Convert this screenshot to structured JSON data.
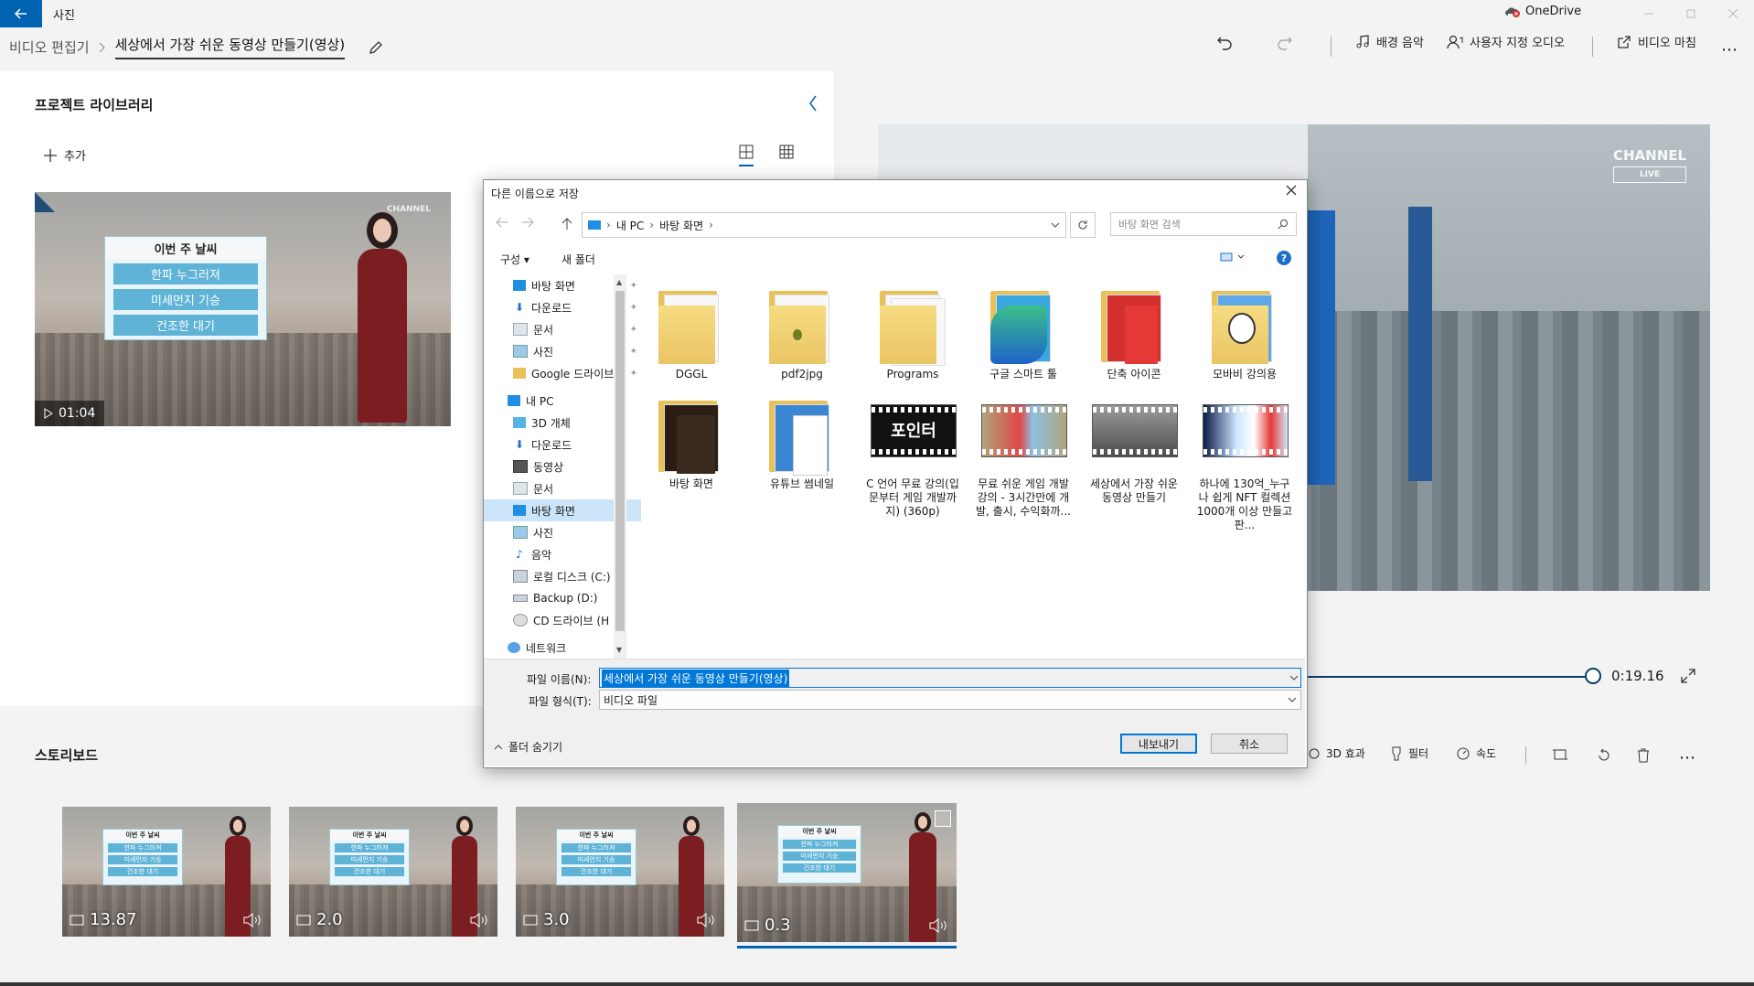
{
  "app": {
    "title": "사진",
    "onedrive_label": "OneDrive"
  },
  "header": {
    "breadcrumb_root": "비디오 편집기",
    "project_title": "세상에서 가장 쉬운 동영상 만들기(영상)",
    "toolbar": {
      "background_music": "배경 음악",
      "custom_audio": "사용자 지정 오디오",
      "finish_video": "비디오 마침"
    }
  },
  "library": {
    "title": "프로젝트 라이브러리",
    "add_label": "추가",
    "item": {
      "duration": "01:04",
      "board_heading": "이번 주 날씨",
      "board_items": [
        "한파 누그러져",
        "미세먼지 기승",
        "건조한 대기"
      ]
    }
  },
  "preview": {
    "current_time": "0:19.16",
    "logo_text": "CHANNEL",
    "logo_badge": "LIVE"
  },
  "storyboard": {
    "title": "스토리보드",
    "tools": [
      "3D 효과",
      "필터",
      "속도"
    ],
    "clips": [
      {
        "duration": "13.87"
      },
      {
        "duration": "2.0"
      },
      {
        "duration": "3.0"
      },
      {
        "duration": "0.3"
      }
    ]
  },
  "dialog": {
    "title": "다른 이름으로 저장",
    "address": [
      "내 PC",
      "바탕 화면"
    ],
    "search_placeholder": "바탕 화면 검색",
    "organize": "구성",
    "new_folder": "새 폴더",
    "help": "?",
    "nav_items": [
      {
        "label": "바탕 화면",
        "pinned": true
      },
      {
        "label": "다운로드",
        "pinned": true
      },
      {
        "label": "문서",
        "pinned": true
      },
      {
        "label": "사진",
        "pinned": true
      },
      {
        "label": "Google 드라이브",
        "pinned": true
      },
      {
        "label": "내 PC"
      },
      {
        "label": "3D 개체"
      },
      {
        "label": "다운로드"
      },
      {
        "label": "동영상"
      },
      {
        "label": "문서"
      },
      {
        "label": "바탕 화면",
        "selected": true
      },
      {
        "label": "사진"
      },
      {
        "label": "음악"
      },
      {
        "label": "로컬 디스크 (C:)"
      },
      {
        "label": "Backup (D:)"
      },
      {
        "label": "CD 드라이브 (H"
      },
      {
        "label": "네트워크"
      }
    ],
    "files": [
      {
        "name": "DGGL",
        "kind": "folder"
      },
      {
        "name": "pdf2jpg",
        "kind": "folder"
      },
      {
        "name": "Programs",
        "kind": "folder"
      },
      {
        "name": "구글 스마트 툴",
        "kind": "folder"
      },
      {
        "name": "단축 아이콘",
        "kind": "folder"
      },
      {
        "name": "모바비 강의용",
        "kind": "folder"
      },
      {
        "name": "바탕 화면",
        "kind": "folder"
      },
      {
        "name": "유튜브 썸네일",
        "kind": "folder"
      },
      {
        "name": "C 언어 무료 강의(입문부터 게임 개발까지) (360p)",
        "kind": "video",
        "thumb_text": "포인터"
      },
      {
        "name": "무료 쉬운 게임 개발 강의 - 3시간만에 개발, 출시, 수익화까...",
        "kind": "video"
      },
      {
        "name": "세상에서 가장 쉬운 동영상 만들기",
        "kind": "video"
      },
      {
        "name": "하나에 130억_누구나 쉽게 NFT 컬렉션 1000개 이상 만들고 판...",
        "kind": "video"
      }
    ],
    "filename_label": "파일 이름(N):",
    "filename_value": "세상에서 가장 쉬운 동영상 만들기(영상)",
    "filetype_label": "파일 형식(T):",
    "filetype_value": "비디오 파일",
    "hide_folders": "폴더 숨기기",
    "export_button": "내보내기",
    "cancel_button": "취소"
  },
  "colors": {
    "accent": "#0063b1",
    "dress": "#7c1d22",
    "board_item": "#5fb3d6"
  }
}
